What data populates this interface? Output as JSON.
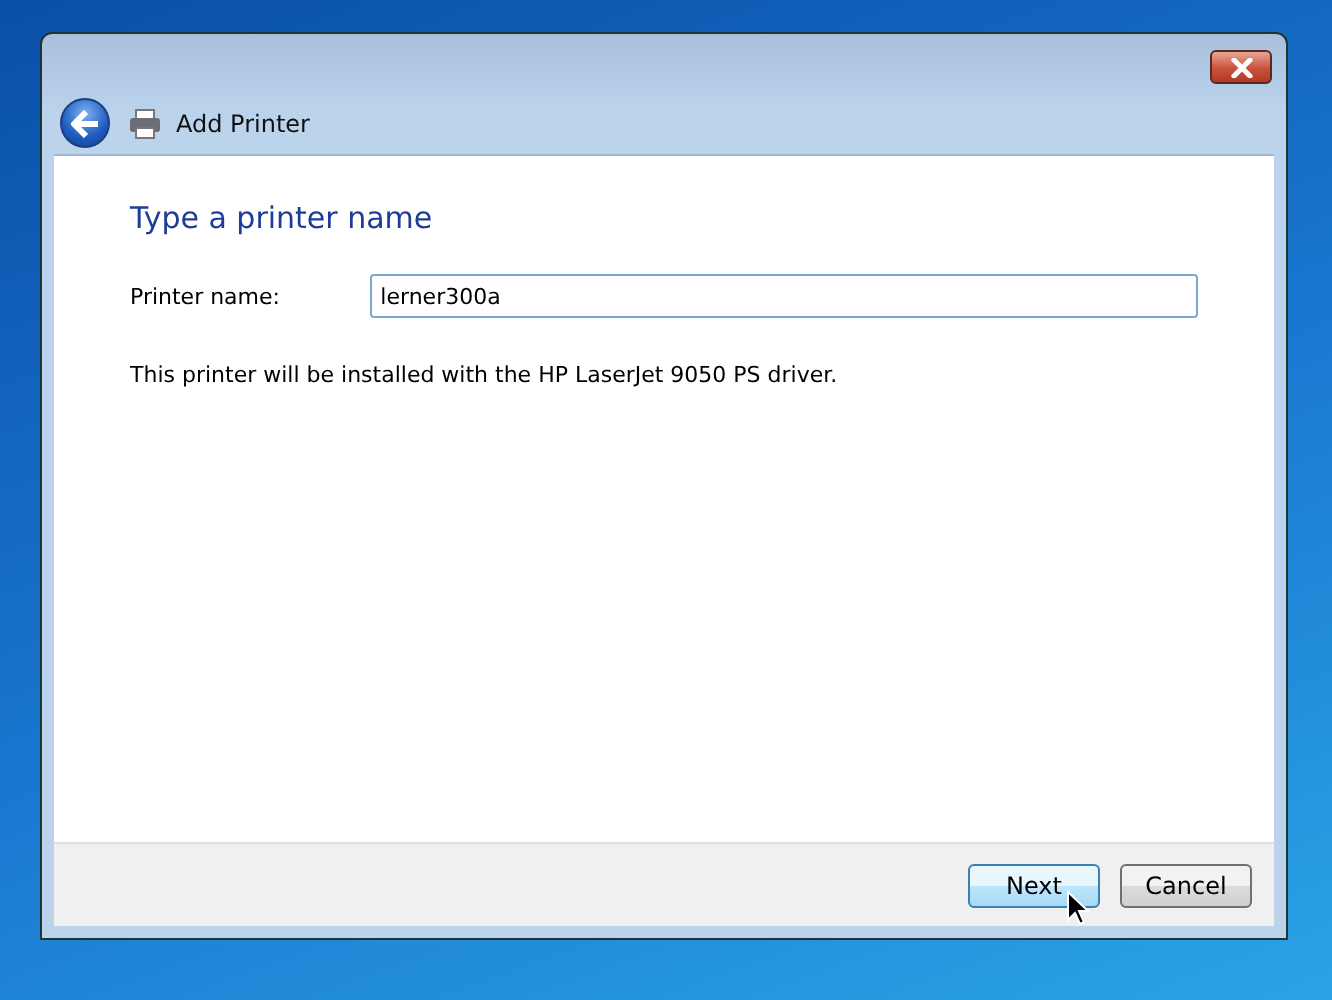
{
  "window": {
    "title": "Add Printer"
  },
  "heading": "Type a printer name",
  "printer_name": {
    "label": "Printer name:",
    "value": "lerner300a"
  },
  "info": "This printer will be installed with the HP LaserJet 9050 PS driver.",
  "buttons": [
    {
      "label": "Next",
      "default": true
    },
    {
      "label": "Cancel",
      "default": false
    }
  ]
}
